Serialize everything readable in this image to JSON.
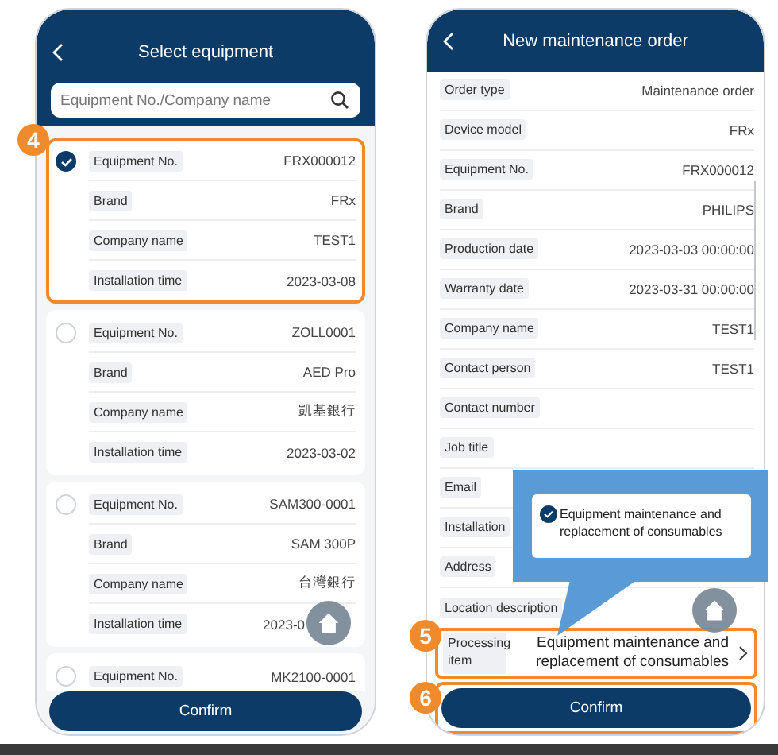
{
  "screens": [
    {
      "kind": "select",
      "title": "Select equipment",
      "search": {
        "placeholder": "Equipment No./Company name"
      },
      "cards": [
        {
          "selected": true,
          "highlighted": true,
          "callout": "4",
          "rows": [
            {
              "label": "Equipment No.",
              "value": "FRX000012"
            },
            {
              "label": "Brand",
              "value": "FRx"
            },
            {
              "label": "Company name",
              "value": "TEST1"
            },
            {
              "label": "Installation time",
              "value": "2023-03-08"
            }
          ]
        },
        {
          "selected": false,
          "highlighted": false,
          "rows": [
            {
              "label": "Equipment No.",
              "value": "ZOLL0001"
            },
            {
              "label": "Brand",
              "value": "AED Pro"
            },
            {
              "label": "Company name",
              "value": "凱基銀行"
            },
            {
              "label": "Installation time",
              "value": "2023-03-02"
            }
          ]
        },
        {
          "selected": false,
          "highlighted": false,
          "rows": [
            {
              "label": "Equipment No.",
              "value": "SAM300-0001"
            },
            {
              "label": "Brand",
              "value": "SAM 300P"
            },
            {
              "label": "Company name",
              "value": "台灣銀行"
            },
            {
              "label": "Installation time",
              "value": "2023-0",
              "partial": true
            }
          ]
        },
        {
          "selected": false,
          "highlighted": false,
          "rows": [
            {
              "label": "Equipment No.",
              "value": "MK2100-0001"
            }
          ]
        }
      ],
      "confirm": {
        "label": "Confirm"
      }
    },
    {
      "kind": "order",
      "title": "New maintenance order",
      "rows": [
        {
          "label": "Order type",
          "value": "Maintenance order"
        },
        {
          "label": "Device model",
          "value": "FRx"
        },
        {
          "label": "Equipment No.",
          "value": "FRX000012"
        },
        {
          "label": "Brand",
          "value": "PHILIPS"
        },
        {
          "label": "Production date",
          "value": "2023-03-03 00:00:00"
        },
        {
          "label": "Warranty date",
          "value": "2023-03-31 00:00:00"
        },
        {
          "label": "Company name",
          "value": "TEST1"
        },
        {
          "label": "Contact person",
          "value": "TEST1"
        },
        {
          "label": "Contact number"
        },
        {
          "label": "Job title"
        },
        {
          "label": "Email"
        },
        {
          "label": "Installation"
        },
        {
          "label": "Address"
        },
        {
          "label": "Location description"
        }
      ],
      "processing": {
        "label": "Processing item",
        "value": "Equipment maintenance and replacement of consumables",
        "callout": "5"
      },
      "popup": {
        "option": "Equipment maintenance and replacement of consumables",
        "checked": true
      },
      "confirm": {
        "label": "Confirm",
        "callout": "6"
      }
    }
  ]
}
